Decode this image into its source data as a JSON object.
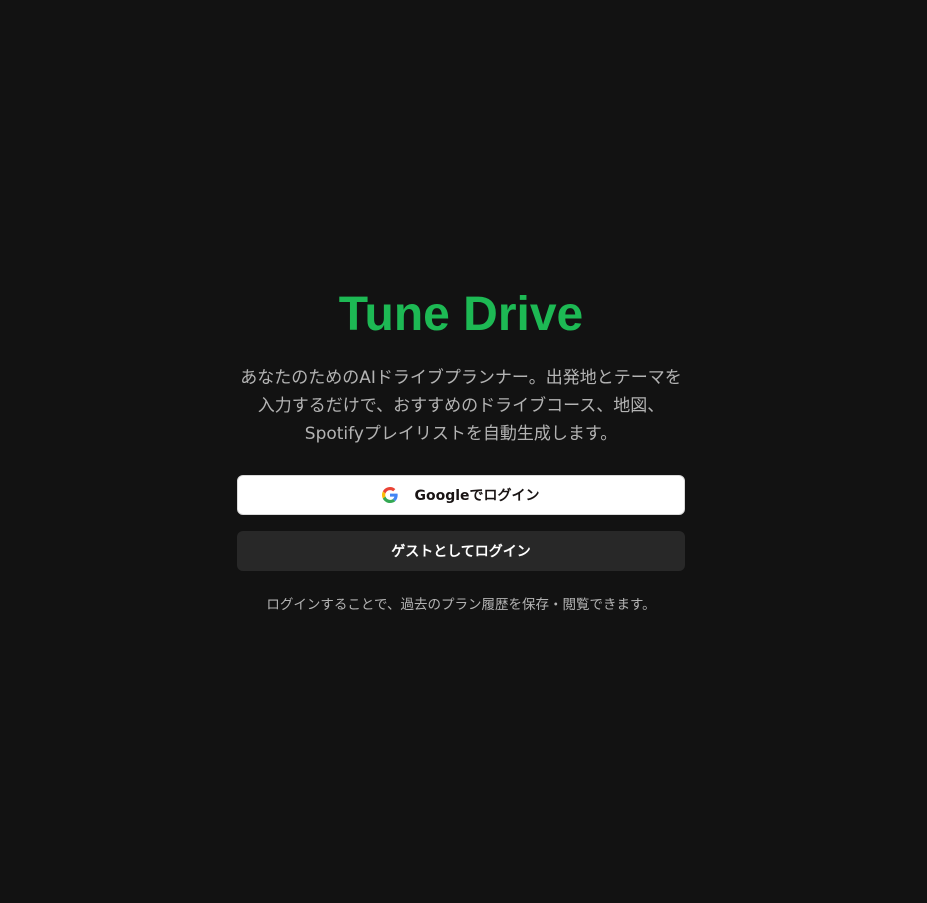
{
  "app": {
    "title": "Tune Drive",
    "description": "あなたのためのAIドライブプランナー。出発地とテーマを入力するだけで、おすすめのドライブコース、地図、Spotifyプレイリストを自動生成します。"
  },
  "auth": {
    "google_label": "Googleでログイン",
    "guest_label": "ゲストとしてログイン",
    "note": "ログインすることで、過去のプラン履歴を保存・閲覧できます。"
  },
  "icons": {
    "google": "google-g-icon"
  },
  "colors": {
    "background": "#121212",
    "accent": "#1db954",
    "text_muted": "#b3b3b3",
    "guest_button": "#282828",
    "google_button": "#ffffff"
  }
}
